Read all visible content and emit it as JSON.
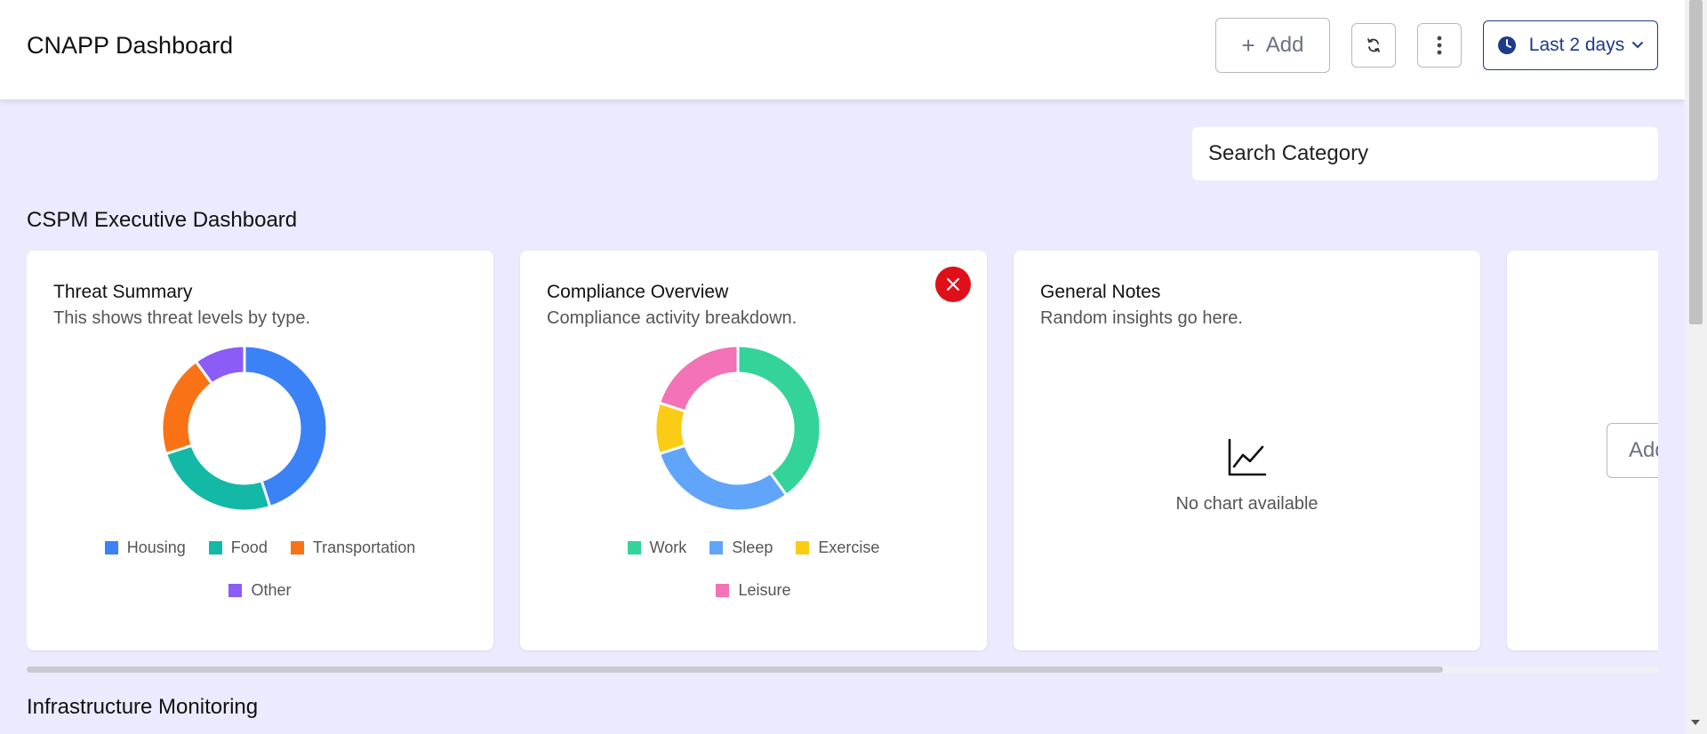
{
  "header": {
    "title": "CNAPP Dashboard",
    "add_label": "Add",
    "time_range_label": "Last 2 days"
  },
  "search": {
    "placeholder": "Search Category"
  },
  "sections": [
    {
      "title": "CSPM Executive Dashboard",
      "widgets": [
        {
          "title": "Threat Summary",
          "subtitle": "This shows threat levels by type.",
          "chart_data": {
            "type": "pie",
            "donut": true,
            "categories": [
              "Housing",
              "Food",
              "Transportation",
              "Other"
            ],
            "values": [
              45,
              25,
              20,
              10
            ],
            "colors": [
              "#3b82f6",
              "#14b8a6",
              "#f97316",
              "#8b5cf6"
            ],
            "legend": "bottom"
          }
        },
        {
          "title": "Compliance Overview",
          "subtitle": "Compliance activity breakdown.",
          "chart_data": {
            "type": "pie",
            "donut": true,
            "categories": [
              "Work",
              "Sleep",
              "Exercise",
              "Leisure"
            ],
            "values": [
              40,
              30,
              10,
              20
            ],
            "colors": [
              "#34d399",
              "#60a5fa",
              "#facc15",
              "#f472b6"
            ],
            "legend": "bottom"
          }
        },
        {
          "title": "General Notes",
          "subtitle": "Random insights go here.",
          "empty_text": "No chart available",
          "empty_icon": "line-chart-icon"
        },
        {
          "add_button_label": "Add"
        }
      ]
    },
    {
      "title": "Infrastructure Monitoring"
    }
  ],
  "colors": {
    "background": "#eceaff",
    "accent": "#1e3a8a",
    "danger": "#e0101a"
  }
}
